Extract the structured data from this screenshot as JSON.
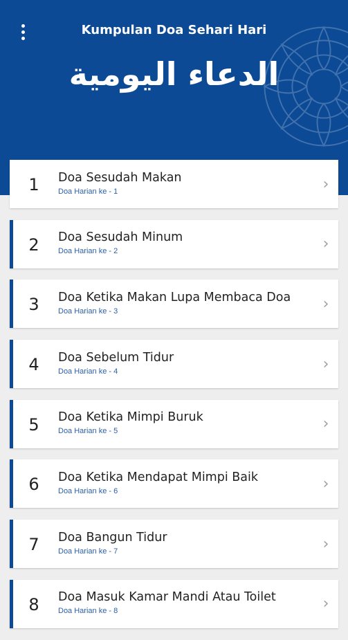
{
  "header": {
    "app_title": "Kumpulan Doa Sehari Hari",
    "arabic_title": "الدعاء اليومية",
    "menu_icon": "more-vertical-icon",
    "background_color": "#0c4a96"
  },
  "list": {
    "chevron_icon": "chevron-right-icon",
    "accent_color": "#0c4a96",
    "items": [
      {
        "number": "1",
        "title": "Doa Sesudah Makan",
        "subtitle": "Doa Harian ke - 1"
      },
      {
        "number": "2",
        "title": "Doa Sesudah Minum",
        "subtitle": "Doa Harian ke - 2"
      },
      {
        "number": "3",
        "title": "Doa Ketika Makan Lupa Membaca Doa",
        "subtitle": "Doa Harian ke - 3"
      },
      {
        "number": "4",
        "title": "Doa Sebelum Tidur",
        "subtitle": "Doa Harian ke - 4"
      },
      {
        "number": "5",
        "title": "Doa Ketika Mimpi Buruk",
        "subtitle": "Doa Harian ke - 5"
      },
      {
        "number": "6",
        "title": "Doa Ketika Mendapat Mimpi Baik",
        "subtitle": "Doa Harian ke - 6"
      },
      {
        "number": "7",
        "title": "Doa Bangun Tidur",
        "subtitle": "Doa Harian ke - 7"
      },
      {
        "number": "8",
        "title": "Doa Masuk Kamar Mandi Atau Toilet",
        "subtitle": "Doa Harian ke - 8"
      }
    ]
  }
}
